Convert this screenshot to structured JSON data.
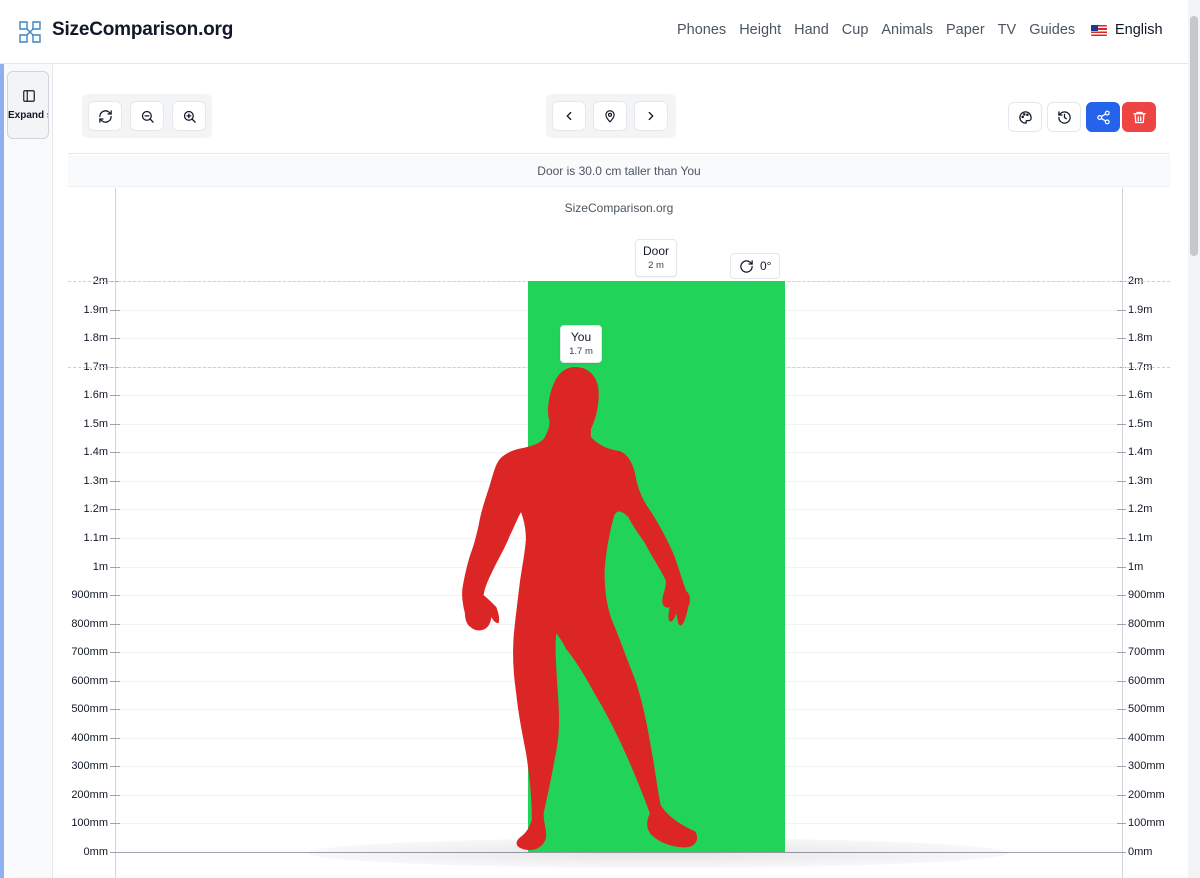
{
  "brand": {
    "name": "SizeComparison.org"
  },
  "nav": {
    "items": [
      "Phones",
      "Height",
      "Hand",
      "Cup",
      "Animals",
      "Paper",
      "TV",
      "Guides"
    ]
  },
  "language": {
    "label": "English",
    "icon": "us-flag-icon"
  },
  "sidebar": {
    "expand_label": "Expand sidebar",
    "icon": "panel-left-icon"
  },
  "toolbar": {
    "left": [
      "refresh-icon",
      "zoom-out-icon",
      "zoom-in-icon"
    ],
    "center": [
      "chevron-left-icon",
      "map-pin-icon",
      "chevron-right-icon"
    ],
    "right": [
      "palette-icon",
      "history-icon",
      "share-icon",
      "trash-icon"
    ]
  },
  "comparison": {
    "text": "Door is 30.0 cm taller than You"
  },
  "canvas": {
    "watermark": "SizeComparison.org",
    "rotation": {
      "value": "0°"
    },
    "ticks": [
      "2m",
      "1.9m",
      "1.8m",
      "1.7m",
      "1.6m",
      "1.5m",
      "1.4m",
      "1.3m",
      "1.2m",
      "1.1m",
      "1m",
      "900mm",
      "800mm",
      "700mm",
      "600mm",
      "500mm",
      "400mm",
      "300mm",
      "200mm",
      "100mm",
      "0mm"
    ],
    "objects": [
      {
        "name": "Door",
        "height_label": "2 m",
        "height_m": 2.0,
        "color": "#22d35a"
      },
      {
        "name": "You",
        "height_label": "1.7 m",
        "height_m": 1.7,
        "color": "#dc2626"
      }
    ]
  },
  "colors": {
    "accent": "#2563eb",
    "danger": "#ef4444",
    "door": "#22d35a",
    "person": "#dc2626"
  }
}
